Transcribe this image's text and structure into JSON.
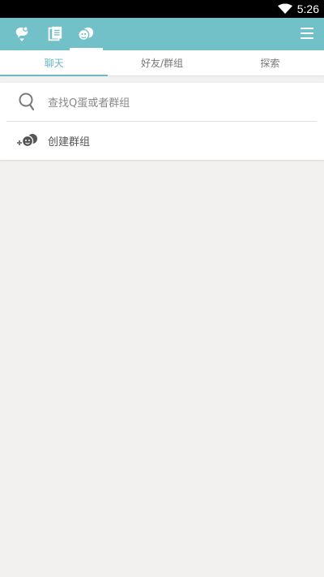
{
  "status_bar": {
    "time": "5:26"
  },
  "top_bar": {
    "bg_color": "#72c0c8",
    "icons": [
      "chat-bubble-icon",
      "notes-icon",
      "groups-faces-icon"
    ],
    "selected_icon": "groups-faces-icon",
    "menu_icon": "hamburger-menu-icon"
  },
  "tabs": [
    {
      "label": "聊天",
      "active": true
    },
    {
      "label": "好友/群组",
      "active": false
    },
    {
      "label": "探索",
      "active": false
    }
  ],
  "search": {
    "label": "查找Q蛋或者群组"
  },
  "create_group": {
    "label": "创建群组"
  }
}
